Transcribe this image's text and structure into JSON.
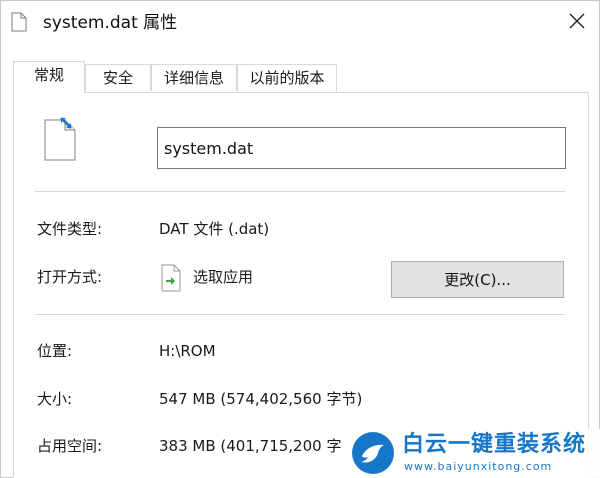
{
  "window": {
    "title": "system.dat 属性",
    "close_glyph": "✕"
  },
  "tabs": [
    {
      "label": "常规",
      "active": true
    },
    {
      "label": "安全",
      "active": false
    },
    {
      "label": "详细信息",
      "active": false
    },
    {
      "label": "以前的版本",
      "active": false
    }
  ],
  "general": {
    "file_name": "system.dat",
    "file_type_label": "文件类型:",
    "file_type_value": "DAT 文件 (.dat)",
    "open_with_label": "打开方式:",
    "open_with_value": "选取应用",
    "change_button": "更改(C)...",
    "location_label": "位置:",
    "location_value": "H:\\ROM",
    "size_label": "大小:",
    "size_value": "547 MB (574,402,560 字节)",
    "size_on_disk_label": "占用空间:",
    "size_on_disk_value": "383 MB (401,715,200 字"
  },
  "watermark": {
    "title": "白云一键重装系统",
    "url": "www.baiyunxitong.com"
  },
  "colors": {
    "accent": "#1677c8",
    "button_bg": "#e1e1e1",
    "border": "#d9d9d9"
  },
  "icons": [
    "file-icon",
    "dat-file-icon",
    "choose-app-icon",
    "close-icon",
    "bird-logo-icon"
  ]
}
